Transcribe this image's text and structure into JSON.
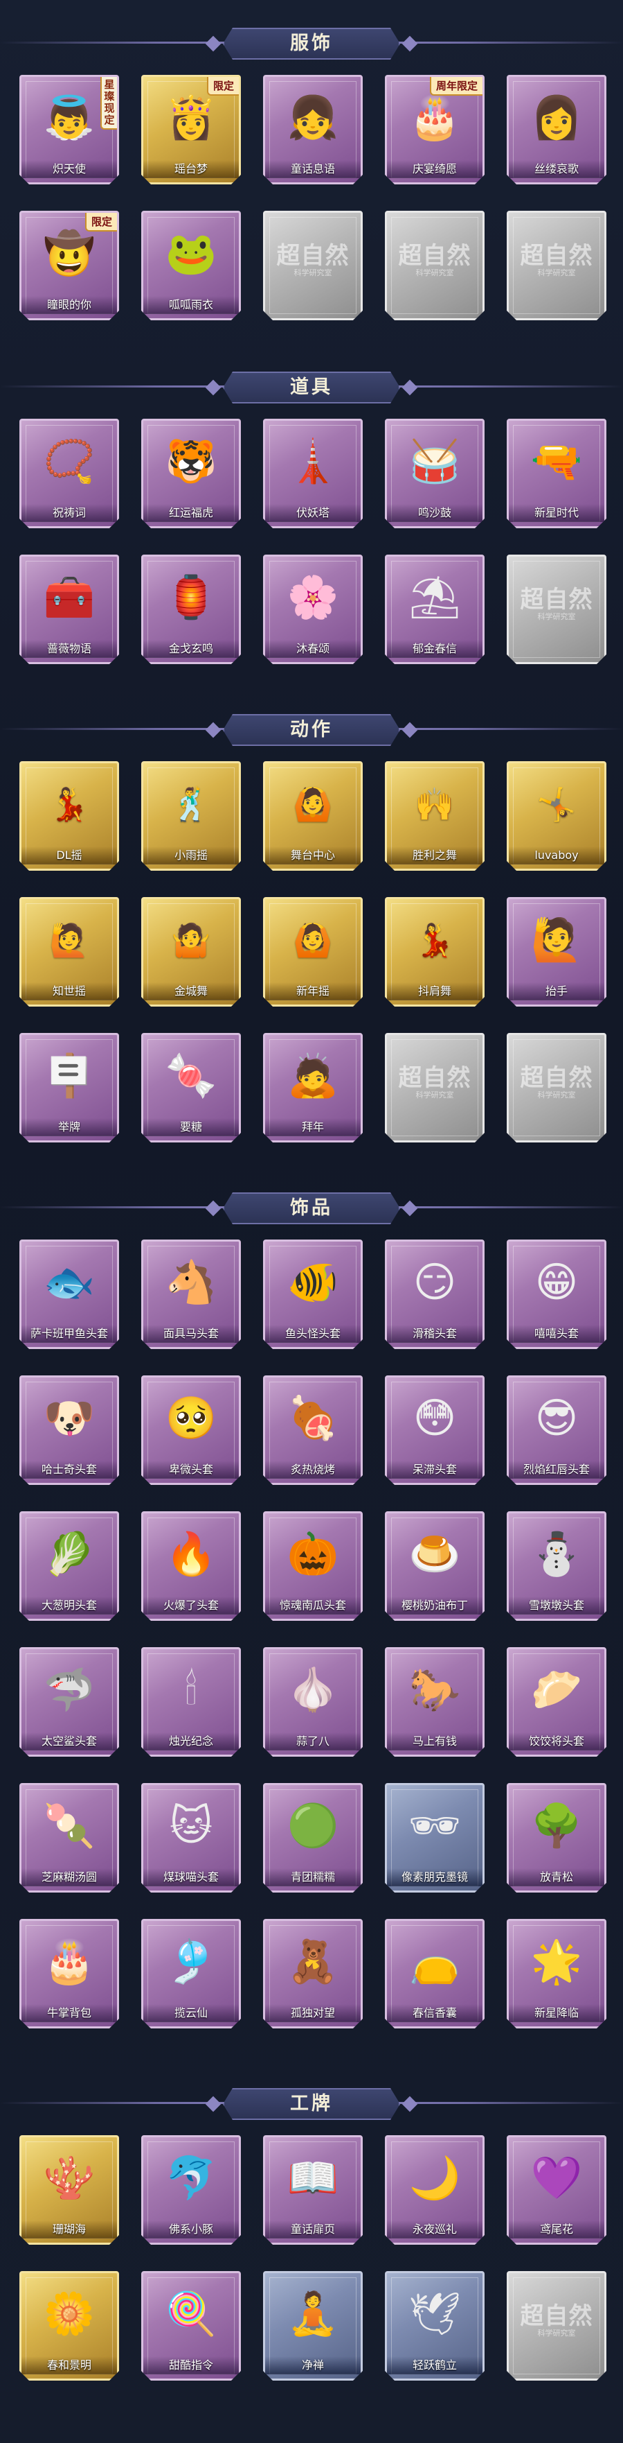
{
  "sections": [
    {
      "title": "服饰",
      "items": [
        {
          "label": "炽天使",
          "rarity": "purple",
          "icon": "angel-costume-icon",
          "glyph": "👼",
          "badge": "星璨现定",
          "badge_style": "vert"
        },
        {
          "label": "瑶台梦",
          "rarity": "gold",
          "icon": "dream-costume-icon",
          "glyph": "👸",
          "badge": "限定"
        },
        {
          "label": "童话息语",
          "rarity": "purple",
          "icon": "fairytale-costume-icon",
          "glyph": "👧"
        },
        {
          "label": "庆宴绮愿",
          "rarity": "purple",
          "icon": "banquet-costume-icon",
          "glyph": "🎂",
          "badge": "周年限定"
        },
        {
          "label": "丝缕哀歌",
          "rarity": "purple",
          "icon": "elegy-costume-icon",
          "glyph": "👩"
        },
        {
          "label": "瞳眼的你",
          "rarity": "purple",
          "icon": "cowgirl-costume-icon",
          "glyph": "🤠",
          "badge": "限定"
        },
        {
          "label": "呱呱雨衣",
          "rarity": "purple",
          "icon": "frog-raincoat-icon",
          "glyph": "🐸"
        },
        {
          "label": "",
          "rarity": "silver",
          "icon": "placeholder-card-icon",
          "watermark": "超自然",
          "watermark_sub": "科学研究室"
        },
        {
          "label": "",
          "rarity": "silver",
          "icon": "placeholder-card-icon",
          "watermark": "超自然",
          "watermark_sub": "科学研究室"
        },
        {
          "label": "",
          "rarity": "silver",
          "icon": "placeholder-card-icon",
          "watermark": "超自然",
          "watermark_sub": "科学研究室"
        }
      ]
    },
    {
      "title": "道具",
      "items": [
        {
          "label": "祝祷词",
          "rarity": "purple",
          "icon": "necklace-icon",
          "glyph": "📿"
        },
        {
          "label": "红运福虎",
          "rarity": "purple",
          "icon": "tiger-icon",
          "glyph": "🐯"
        },
        {
          "label": "伏妖塔",
          "rarity": "purple",
          "icon": "pagoda-icon",
          "glyph": "🗼"
        },
        {
          "label": "鸣沙鼓",
          "rarity": "purple",
          "icon": "drum-icon",
          "glyph": "🥁"
        },
        {
          "label": "新星时代",
          "rarity": "purple",
          "icon": "revolver-icon",
          "glyph": "🔫"
        },
        {
          "label": "蔷薇物语",
          "rarity": "purple",
          "icon": "medkit-icon",
          "glyph": "🧰"
        },
        {
          "label": "金戈玄鸣",
          "rarity": "purple",
          "icon": "lantern-icon",
          "glyph": "🏮"
        },
        {
          "label": "沐春颂",
          "rarity": "purple",
          "icon": "flower-branch-icon",
          "glyph": "🌸"
        },
        {
          "label": "郁金春信",
          "rarity": "purple",
          "icon": "parasol-icon",
          "glyph": "⛱"
        },
        {
          "label": "",
          "rarity": "silver",
          "icon": "placeholder-card-icon",
          "watermark": "超自然",
          "watermark_sub": "科学研究室"
        }
      ]
    },
    {
      "title": "动作",
      "items": [
        {
          "label": "DL摇",
          "rarity": "gold",
          "icon": "dance-pose-icon",
          "glyph": "💃",
          "pose": true
        },
        {
          "label": "小雨摇",
          "rarity": "gold",
          "icon": "dance-pose-icon",
          "glyph": "🕺",
          "pose": true
        },
        {
          "label": "舞台中心",
          "rarity": "gold",
          "icon": "dance-pose-icon",
          "glyph": "🙆",
          "pose": true
        },
        {
          "label": "胜利之舞",
          "rarity": "gold",
          "icon": "dance-pose-icon",
          "glyph": "🙌",
          "pose": true
        },
        {
          "label": "luvaboy",
          "rarity": "gold",
          "icon": "dance-pose-icon",
          "glyph": "🤸",
          "pose": true
        },
        {
          "label": "知世摇",
          "rarity": "gold",
          "icon": "dance-pose-icon",
          "glyph": "🙋",
          "pose": true
        },
        {
          "label": "金城舞",
          "rarity": "gold",
          "icon": "dance-pose-icon",
          "glyph": "🤷",
          "pose": true
        },
        {
          "label": "新年摇",
          "rarity": "gold",
          "icon": "dance-pose-icon",
          "glyph": "🙆",
          "pose": true
        },
        {
          "label": "抖肩舞",
          "rarity": "gold",
          "icon": "dance-pose-icon",
          "glyph": "💃",
          "pose": true
        },
        {
          "label": "抬手",
          "rarity": "purple",
          "icon": "raise-hand-icon",
          "glyph": "🙋"
        },
        {
          "label": "举牌",
          "rarity": "purple",
          "icon": "sign-holder-icon",
          "glyph": "🪧"
        },
        {
          "label": "要糖",
          "rarity": "purple",
          "icon": "candy-request-icon",
          "glyph": "🍬"
        },
        {
          "label": "拜年",
          "rarity": "purple",
          "icon": "bow-greeting-icon",
          "glyph": "🙇"
        },
        {
          "label": "",
          "rarity": "silver",
          "icon": "placeholder-card-icon",
          "watermark": "超自然",
          "watermark_sub": "科学研究室"
        },
        {
          "label": "",
          "rarity": "silver",
          "icon": "placeholder-card-icon",
          "watermark": "超自然",
          "watermark_sub": "科学研究室"
        }
      ]
    },
    {
      "title": "饰品",
      "items": [
        {
          "label": "萨卡班甲鱼头套",
          "rarity": "purple",
          "icon": "fish-head-icon",
          "glyph": "🐟"
        },
        {
          "label": "面具马头套",
          "rarity": "purple",
          "icon": "horse-head-icon",
          "glyph": "🐴"
        },
        {
          "label": "鱼头怪头套",
          "rarity": "purple",
          "icon": "fishman-head-icon",
          "glyph": "🐠"
        },
        {
          "label": "滑稽头套",
          "rarity": "purple",
          "icon": "funny-face-icon",
          "glyph": "😏"
        },
        {
          "label": "嘻嘻头套",
          "rarity": "purple",
          "icon": "grin-face-icon",
          "glyph": "😁"
        },
        {
          "label": "哈士奇头套",
          "rarity": "purple",
          "icon": "husky-head-icon",
          "glyph": "🐶"
        },
        {
          "label": "卑微头套",
          "rarity": "purple",
          "icon": "humble-face-icon",
          "glyph": "🥺"
        },
        {
          "label": "炙热烧烤",
          "rarity": "purple",
          "icon": "bbq-head-icon",
          "glyph": "🍖"
        },
        {
          "label": "呆滞头套",
          "rarity": "purple",
          "icon": "dazed-face-icon",
          "glyph": "😳"
        },
        {
          "label": "烈焰红唇头套",
          "rarity": "purple",
          "icon": "pikachu-head-icon",
          "glyph": "😎"
        },
        {
          "label": "大葱明头套",
          "rarity": "purple",
          "icon": "scallion-head-icon",
          "glyph": "🥬"
        },
        {
          "label": "火爆了头套",
          "rarity": "purple",
          "icon": "fire-head-icon",
          "glyph": "🔥"
        },
        {
          "label": "惊魂南瓜头套",
          "rarity": "purple",
          "icon": "pumpkin-head-icon",
          "glyph": "🎃"
        },
        {
          "label": "樱桃奶油布丁",
          "rarity": "purple",
          "icon": "pudding-head-icon",
          "glyph": "🍮"
        },
        {
          "label": "雪墩墩头套",
          "rarity": "purple",
          "icon": "snowman-head-icon",
          "glyph": "⛄"
        },
        {
          "label": "太空鲨头套",
          "rarity": "purple",
          "icon": "shark-head-icon",
          "glyph": "🦈"
        },
        {
          "label": "烛光纪念",
          "rarity": "purple",
          "icon": "candle-head-icon",
          "glyph": "🕯"
        },
        {
          "label": "蒜了八",
          "rarity": "purple",
          "icon": "garlic-head-icon",
          "glyph": "🧄"
        },
        {
          "label": "马上有钱",
          "rarity": "purple",
          "icon": "horse-toy-icon",
          "glyph": "🐎"
        },
        {
          "label": "饺饺将头套",
          "rarity": "purple",
          "icon": "dumpling-head-icon",
          "glyph": "🥟"
        },
        {
          "label": "芝麻糊汤圆",
          "rarity": "purple",
          "icon": "tangyuan-head-icon",
          "glyph": "🍡"
        },
        {
          "label": "煤球喵头套",
          "rarity": "purple",
          "icon": "cat-head-icon",
          "glyph": "🐱"
        },
        {
          "label": "青团糯糯",
          "rarity": "purple",
          "icon": "green-dumpling-icon",
          "glyph": "🟢"
        },
        {
          "label": "像素朋克墨镜",
          "rarity": "blue",
          "icon": "pixel-glasses-icon",
          "glyph": "🕶"
        },
        {
          "label": "放青松",
          "rarity": "purple",
          "icon": "bonsai-icon",
          "glyph": "🌳"
        },
        {
          "label": "牛掌背包",
          "rarity": "purple",
          "icon": "cake-backpack-icon",
          "glyph": "🎂"
        },
        {
          "label": "揽云仙",
          "rarity": "purple",
          "icon": "pendant-cloud-icon",
          "glyph": "🎐"
        },
        {
          "label": "孤独对望",
          "rarity": "purple",
          "icon": "pendant-figure-icon",
          "glyph": "🧸"
        },
        {
          "label": "春信香囊",
          "rarity": "purple",
          "icon": "sachet-icon",
          "glyph": "👝"
        },
        {
          "label": "新星降临",
          "rarity": "purple",
          "icon": "star-pendant-icon",
          "glyph": "🌟"
        }
      ]
    },
    {
      "title": "工牌",
      "items": [
        {
          "label": "珊瑚海",
          "rarity": "gold",
          "icon": "coral-badge-icon",
          "glyph": "🪸"
        },
        {
          "label": "佛系小豚",
          "rarity": "purple",
          "icon": "dolphin-badge-icon",
          "glyph": "🐬"
        },
        {
          "label": "童话扉页",
          "rarity": "purple",
          "icon": "storybook-badge-icon",
          "glyph": "📖"
        },
        {
          "label": "永夜巡礼",
          "rarity": "purple",
          "icon": "night-badge-icon",
          "glyph": "🌙"
        },
        {
          "label": "鸢尾花",
          "rarity": "purple",
          "icon": "iris-badge-icon",
          "glyph": "💜"
        },
        {
          "label": "春和景明",
          "rarity": "gold",
          "icon": "spring-badge-icon",
          "glyph": "🌼"
        },
        {
          "label": "甜酷指令",
          "rarity": "purple",
          "icon": "sweet-badge-icon",
          "glyph": "🍭"
        },
        {
          "label": "净禅",
          "rarity": "blue",
          "icon": "zen-badge-icon",
          "glyph": "🧘"
        },
        {
          "label": "轻跃鹤立",
          "rarity": "blue",
          "icon": "crane-badge-icon",
          "glyph": "🕊"
        },
        {
          "label": "",
          "rarity": "silver",
          "icon": "placeholder-card-icon",
          "watermark": "超自然",
          "watermark_sub": "科学研究室"
        }
      ]
    }
  ]
}
